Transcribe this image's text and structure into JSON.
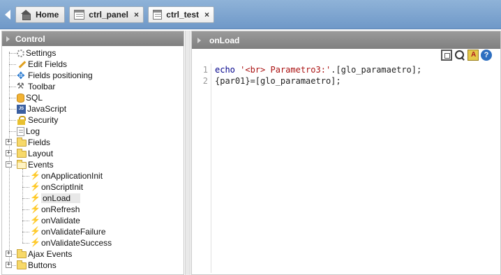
{
  "tabs": [
    {
      "label": "Home",
      "icon": "home-icon"
    },
    {
      "label": "ctrl_panel",
      "icon": "app-icon"
    },
    {
      "label": "ctrl_test",
      "icon": "app-icon"
    }
  ],
  "tab_close_glyph": "×",
  "left_panel": {
    "title": "Control",
    "tree": [
      {
        "label": "Settings",
        "icon": "gear-icon"
      },
      {
        "label": "Edit Fields",
        "icon": "pencil-icon"
      },
      {
        "label": "Fields positioning",
        "icon": "move-icon"
      },
      {
        "label": "Toolbar",
        "icon": "toolbar-icon"
      },
      {
        "label": "SQL",
        "icon": "database-icon"
      },
      {
        "label": "JavaScript",
        "icon": "javascript-icon"
      },
      {
        "label": "Security",
        "icon": "lock-icon"
      },
      {
        "label": "Log",
        "icon": "log-icon"
      },
      {
        "label": "Fields",
        "icon": "folder-icon",
        "expander": "+"
      },
      {
        "label": "Layout",
        "icon": "folder-icon",
        "expander": "+"
      },
      {
        "label": "Events",
        "icon": "folder-open-icon",
        "expander": "−"
      },
      {
        "label": "onApplicationInit",
        "icon": "bolt-icon",
        "child": true
      },
      {
        "label": "onScriptInit",
        "icon": "bolt-icon",
        "child": true
      },
      {
        "label": "onLoad",
        "icon": "bolt-icon",
        "child": true,
        "selected": true
      },
      {
        "label": "onRefresh",
        "icon": "bolt-gray-icon",
        "child": true
      },
      {
        "label": "onValidate",
        "icon": "bolt-gray-icon",
        "child": true
      },
      {
        "label": "onValidateFailure",
        "icon": "bolt-gray-icon",
        "child": true
      },
      {
        "label": "onValidateSuccess",
        "icon": "bolt-gray-icon",
        "child": true
      },
      {
        "label": "Ajax Events",
        "icon": "folder-icon",
        "expander": "+"
      },
      {
        "label": "Buttons",
        "icon": "folder-icon",
        "expander": "+"
      }
    ]
  },
  "editor": {
    "title": "onLoad",
    "toolbar": [
      "fullscreen-icon",
      "search-icon",
      "replace-icon",
      "help-icon"
    ],
    "lines": [
      {
        "num": "1",
        "kw": "echo ",
        "str": "'<br> Parametro3:'",
        "rest": ".[glo_paramaetro];"
      },
      {
        "num": "2",
        "kw": "",
        "str": "",
        "rest": "{par01}=[glo_paramaetro];"
      }
    ]
  },
  "colors": {
    "tabbar": "#7aa2d0",
    "header": "#8c8c8c",
    "keyword": "#00008b",
    "string": "#a11111"
  }
}
